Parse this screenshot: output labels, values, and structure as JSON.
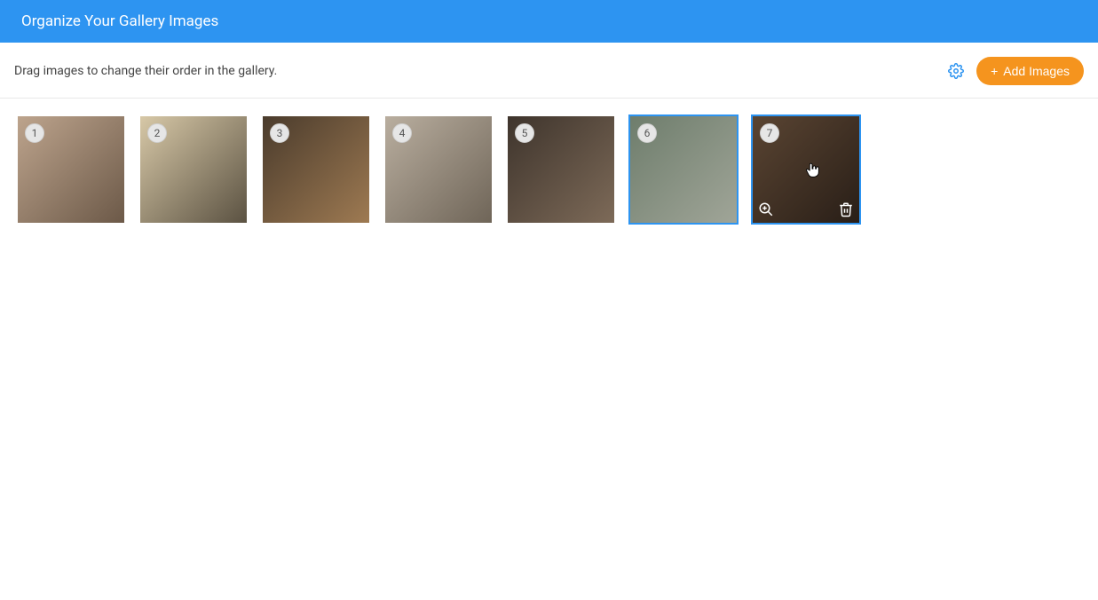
{
  "header": {
    "title": "Organize Your Gallery Images"
  },
  "toolbar": {
    "instruction": "Drag images to change their order in the gallery.",
    "settings_icon": "gear-icon",
    "add_button_label": "Add Images",
    "add_button_plus": "+"
  },
  "gallery": {
    "items": [
      {
        "number": "1",
        "selected": false,
        "hovered": false
      },
      {
        "number": "2",
        "selected": false,
        "hovered": false
      },
      {
        "number": "3",
        "selected": false,
        "hovered": false
      },
      {
        "number": "4",
        "selected": false,
        "hovered": false
      },
      {
        "number": "5",
        "selected": false,
        "hovered": false
      },
      {
        "number": "6",
        "selected": true,
        "hovered": false
      },
      {
        "number": "7",
        "selected": true,
        "hovered": true
      }
    ],
    "hover_actions": {
      "zoom_icon": "zoom-in-icon",
      "delete_icon": "trash-icon"
    }
  },
  "colors": {
    "header_bg": "#2D94F1",
    "accent": "#F5941E",
    "selection": "#2D94F1"
  }
}
